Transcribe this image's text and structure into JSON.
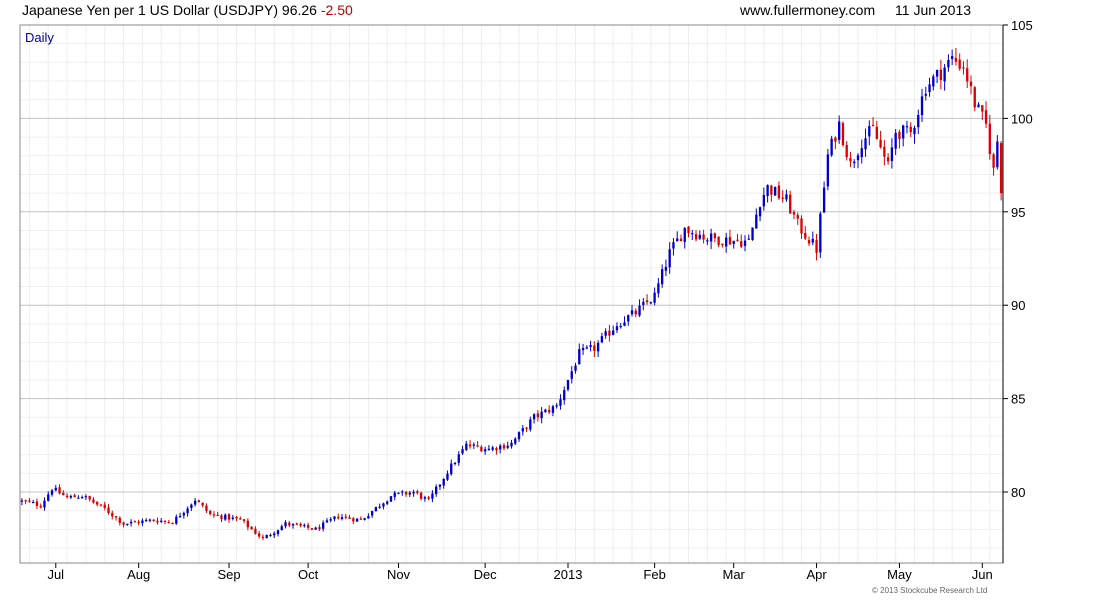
{
  "header": {
    "title": "Japanese Yen per 1 US Dollar (USDJPY)",
    "last_price": "96.26",
    "change": "-2.50",
    "website": "www.fullermoney.com",
    "date": "11 Jun 2013"
  },
  "copyright": "© 2013 Stockcube Research Ltd",
  "colors": {
    "up": "#0000cc",
    "down": "#dd0000",
    "grid": "#d8d8d8",
    "axis": "#000000",
    "interval_label": "#0000aa"
  },
  "chart_data": {
    "type": "candlestick",
    "interval_label": "Daily",
    "ylim": [
      76.2,
      105
    ],
    "y_ticks": [
      80,
      85,
      90,
      95,
      100,
      105
    ],
    "grid": true,
    "x_tick_labels": [
      "Jul",
      "Aug",
      "Sep",
      "Oct",
      "Nov",
      "Dec",
      "2013",
      "Feb",
      "Mar",
      "Apr",
      "May",
      "Jun"
    ],
    "x_tick_positions": [
      9,
      31,
      55,
      76,
      100,
      123,
      145,
      168,
      189,
      211,
      233,
      255
    ],
    "x_count": 261,
    "anchors": [
      [
        0,
        79.5
      ],
      [
        5,
        79.3
      ],
      [
        8,
        80.2
      ],
      [
        12,
        79.7
      ],
      [
        16,
        79.8
      ],
      [
        22,
        79.1
      ],
      [
        27,
        78.3
      ],
      [
        35,
        78.5
      ],
      [
        40,
        78.4
      ],
      [
        46,
        79.6
      ],
      [
        50,
        78.8
      ],
      [
        58,
        78.5
      ],
      [
        64,
        77.5
      ],
      [
        70,
        78.3
      ],
      [
        78,
        78.0
      ],
      [
        84,
        78.7
      ],
      [
        90,
        78.5
      ],
      [
        98,
        79.8
      ],
      [
        104,
        80.0
      ],
      [
        108,
        79.5
      ],
      [
        113,
        81.1
      ],
      [
        118,
        82.5
      ],
      [
        124,
        82.3
      ],
      [
        130,
        82.6
      ],
      [
        136,
        84.0
      ],
      [
        142,
        84.6
      ],
      [
        148,
        87.4
      ],
      [
        152,
        87.7
      ],
      [
        158,
        89.0
      ],
      [
        163,
        89.6
      ],
      [
        168,
        90.5
      ],
      [
        172,
        92.8
      ],
      [
        176,
        94.1
      ],
      [
        182,
        93.6
      ],
      [
        187,
        93.5
      ],
      [
        193,
        93.4
      ],
      [
        196,
        95.6
      ],
      [
        198,
        96.3
      ],
      [
        203,
        95.6
      ],
      [
        206,
        94.3
      ],
      [
        211,
        93.0
      ],
      [
        214,
        98.0
      ],
      [
        217,
        99.7
      ],
      [
        220,
        97.5
      ],
      [
        223,
        98.8
      ],
      [
        226,
        99.4
      ],
      [
        230,
        97.4
      ],
      [
        232,
        99.3
      ],
      [
        236,
        99.2
      ],
      [
        240,
        101.7
      ],
      [
        244,
        102.5
      ],
      [
        247,
        103.2
      ],
      [
        250,
        102.8
      ],
      [
        253,
        100.8
      ],
      [
        256,
        99.6
      ],
      [
        258,
        97.2
      ],
      [
        259,
        98.8
      ],
      [
        260,
        96.3
      ]
    ]
  }
}
